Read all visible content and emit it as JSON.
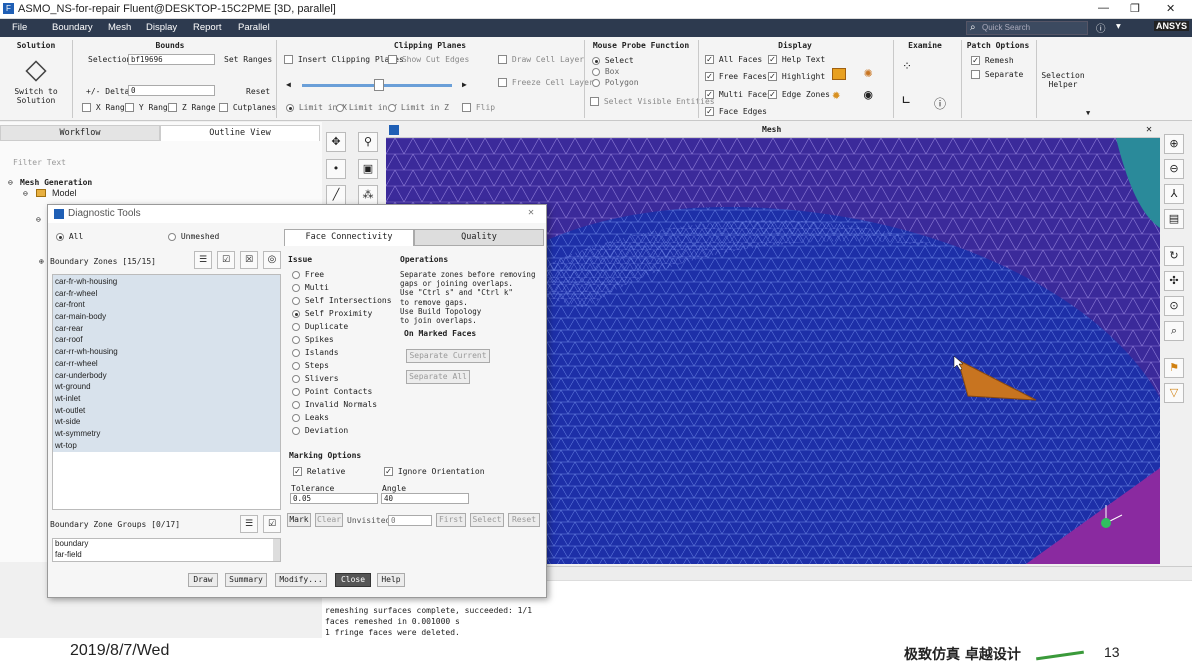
{
  "window": {
    "title": "ASMO_NS-for-repair Fluent@DESKTOP-15C2PME  [3D, parallel]",
    "min": "—",
    "max": "❐",
    "close": "✕"
  },
  "menu": [
    "File",
    "Boundary",
    "Mesh",
    "Display",
    "Report",
    "Parallel"
  ],
  "search_placeholder": "Quick Search",
  "brand": "ANSYS",
  "ribbon": {
    "solution": {
      "title": "Solution",
      "button": "Switch to\nSolution"
    },
    "bounds": {
      "title": "Bounds",
      "selection_label": "Selection",
      "selection_value": "bf19696",
      "set_ranges": "Set Ranges",
      "delta_label": "+/- Delta",
      "delta_value": "0",
      "reset": "Reset",
      "x_range": "X Range",
      "y_range": "Y Range",
      "z_range": "Z Range",
      "cutplanes": "Cutplanes"
    },
    "clipping": {
      "title": "Clipping Planes",
      "insert": "Insert Clipping Planes",
      "show_cut": "Show Cut Edges",
      "draw_cell": "Draw Cell Layer",
      "freeze_cell": "Freeze Cell Layer",
      "limit_x": "Limit in X",
      "limit_y": "Limit in Y",
      "limit_z": "Limit in Z",
      "flip": "Flip"
    },
    "probe": {
      "title": "Mouse Probe Function",
      "select": "Select",
      "box": "Box",
      "polygon": "Polygon",
      "select_visible": "Select Visible Entities"
    },
    "display": {
      "title": "Display",
      "all_faces": "All Faces",
      "free_faces": "Free Faces",
      "multi_faces": "Multi Faces",
      "face_edges": "Face Edges",
      "help_text": "Help Text",
      "highlight": "Highlight",
      "edge_zones": "Edge Zones"
    },
    "examine": {
      "title": "Examine"
    },
    "patch": {
      "title": "Patch Options",
      "remesh": "Remesh",
      "separate": "Separate"
    },
    "selection_helper": "Selection\nHelper"
  },
  "tabs": {
    "workflow": "Workflow",
    "outline": "Outline View"
  },
  "filter_placeholder": "Filter Text",
  "tree": {
    "root": "Mesh Generation",
    "model": "Model"
  },
  "viewport": {
    "title": "Mesh"
  },
  "diag": {
    "title": "Diagnostic Tools",
    "all": "All",
    "unmeshed": "Unmeshed",
    "bz_label": "Boundary Zones [15/15]",
    "zones": [
      "car-fr-wh-housing",
      "car-fr-wheel",
      "car-front",
      "car-main-body",
      "car-rear",
      "car-roof",
      "car-rr-wh-housing",
      "car-rr-wheel",
      "car-underbody",
      "wt-ground",
      "wt-inlet",
      "wt-outlet",
      "wt-side",
      "wt-symmetry",
      "wt-top"
    ],
    "bzg_label": "Boundary Zone Groups [0/17]",
    "groups": [
      "boundary",
      "far-field"
    ],
    "tab_fc": "Face Connectivity",
    "tab_q": "Quality",
    "issue_title": "Issue",
    "issues": [
      "Free",
      "Multi",
      "Self Intersections",
      "Self Proximity",
      "Duplicate",
      "Spikes",
      "Islands",
      "Steps",
      "Slivers",
      "Point Contacts",
      "Invalid Normals",
      "Leaks",
      "Deviation"
    ],
    "ops_title": "Operations",
    "ops_text": [
      "Separate zones before removing",
      "gaps or joining overlaps.",
      "Use \"Ctrl s\" and \"Ctrl k\"",
      "to remove gaps.",
      "Use Build Topology",
      "to join overlaps."
    ],
    "on_marked": "On Marked Faces",
    "sep_current": "Separate Current",
    "sep_all": "Separate All",
    "marking_title": "Marking Options",
    "relative": "Relative",
    "ignore_orient": "Ignore Orientation",
    "tol_label": "Tolerance",
    "tol_value": "0.05",
    "angle_label": "Angle",
    "angle_value": "40",
    "mark": "Mark",
    "clear": "Clear",
    "unvisited": "Unvisited",
    "unvisited_value": "0",
    "first": "First",
    "select": "Select",
    "reset": "Reset",
    "draw": "Draw",
    "summary": "Summary",
    "modify": "Modify...",
    "close": "Close",
    "help": "Help"
  },
  "console": [
    "remeshing surfaces complete, succeeded: 1/1",
    "faces remeshed in 0.001000 s",
    "1 fringe faces were deleted."
  ],
  "footer": {
    "date": "2019/8/7/Wed",
    "slogan": "极致仿真 卓越设计",
    "page": "13"
  },
  "colors": {
    "menubar": "#2d3a4f",
    "mesh_bg": "#3b2a9a",
    "mesh_body": "#1d2fa8",
    "arrow": "#c87420"
  }
}
